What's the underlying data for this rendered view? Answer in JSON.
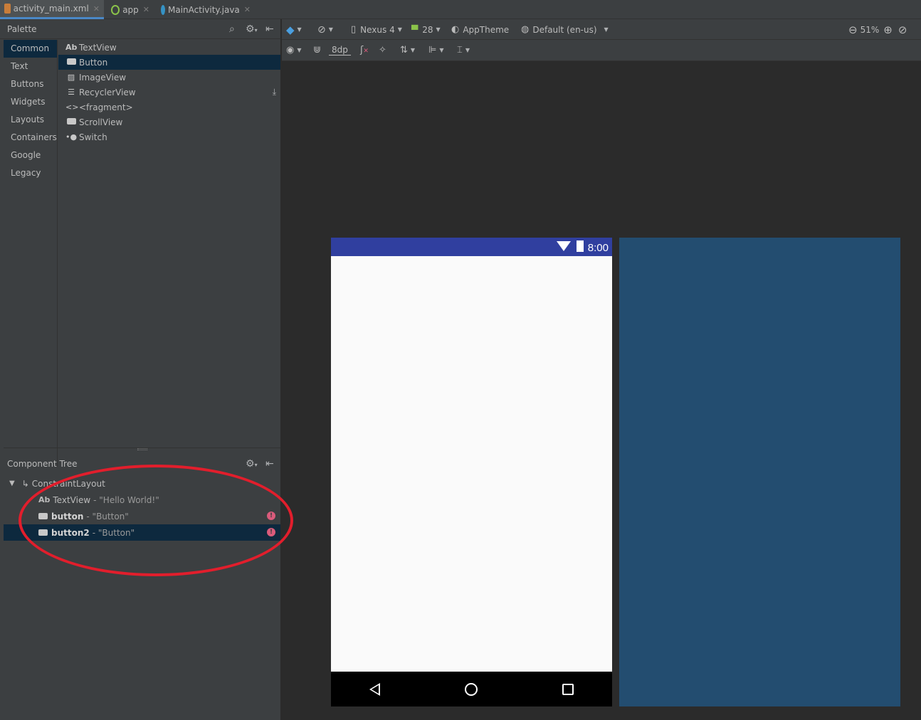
{
  "tabs": [
    {
      "label": "activity_main.xml",
      "icon": "layout-file-icon",
      "active": true
    },
    {
      "label": "app",
      "icon": "android-module-icon",
      "active": false
    },
    {
      "label": "MainActivity.java",
      "icon": "java-class-icon",
      "active": false
    }
  ],
  "palette": {
    "title": "Palette",
    "categories": [
      "Common",
      "Text",
      "Buttons",
      "Widgets",
      "Layouts",
      "Containers",
      "Google",
      "Legacy"
    ],
    "selected_category": "Common",
    "items": [
      {
        "label": "TextView",
        "icon": "textview-icon"
      },
      {
        "label": "Button",
        "icon": "button-icon"
      },
      {
        "label": "ImageView",
        "icon": "image-icon"
      },
      {
        "label": "RecyclerView",
        "icon": "list-icon"
      },
      {
        "label": "<fragment>",
        "icon": "code-icon"
      },
      {
        "label": "ScrollView",
        "icon": "scrollview-icon"
      },
      {
        "label": "Switch",
        "icon": "switch-icon"
      }
    ],
    "selected_item": "Button"
  },
  "component_tree": {
    "title": "Component Tree",
    "root": "ConstraintLayout",
    "rows": [
      {
        "name": "TextView",
        "detail": "- \"Hello World!\"",
        "bold": false,
        "error": false
      },
      {
        "name": "button",
        "detail": "- \"Button\"",
        "bold": true,
        "error": true
      },
      {
        "name": "button2",
        "detail": "- \"Button\"",
        "bold": true,
        "error": true
      }
    ],
    "selected_row": "button2"
  },
  "toolbar": {
    "device": "Nexus 4",
    "api": "28",
    "theme": "AppTheme",
    "locale": "Default (en-us)",
    "zoom": "51%",
    "margin": "8dp"
  },
  "preview": {
    "time": "8:00"
  },
  "colors": {
    "status_bar": "#303f9f",
    "blueprint": "#234d70",
    "annotation": "#e21e2c",
    "error": "#d95b7b",
    "selection": "#0d293e"
  }
}
